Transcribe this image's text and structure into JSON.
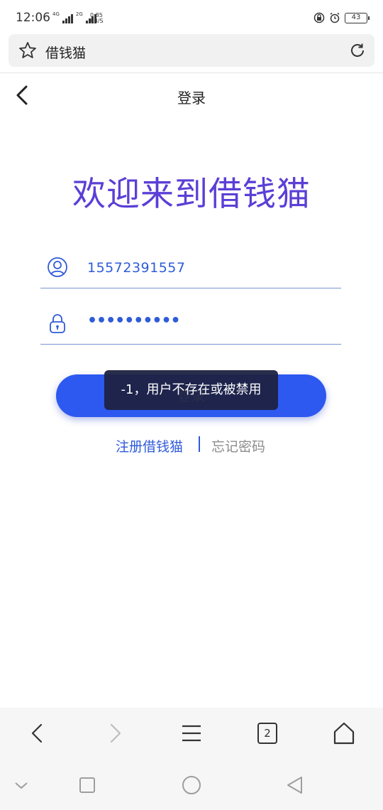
{
  "status_bar": {
    "time": "12:06",
    "network_primary": "4G",
    "network_secondary": "2G",
    "speed_value": "0.85",
    "speed_unit": "KB/S",
    "battery": "43"
  },
  "browser": {
    "page_title": "借钱猫",
    "tab_count": "2"
  },
  "header": {
    "title": "登录"
  },
  "welcome_text": "欢迎来到借钱猫",
  "form": {
    "phone_value": "15572391557",
    "password_mask": "••••••••••"
  },
  "login_button_label": "登录",
  "links": {
    "register": "注册借钱猫",
    "forgot": "忘记密码"
  },
  "toast": "-1，用户不存在或被禁用",
  "colors": {
    "accent": "#2d59f0",
    "welcome": "#5b3fd6",
    "link": "#2f5bd8",
    "muted": "#8c8c8c"
  }
}
